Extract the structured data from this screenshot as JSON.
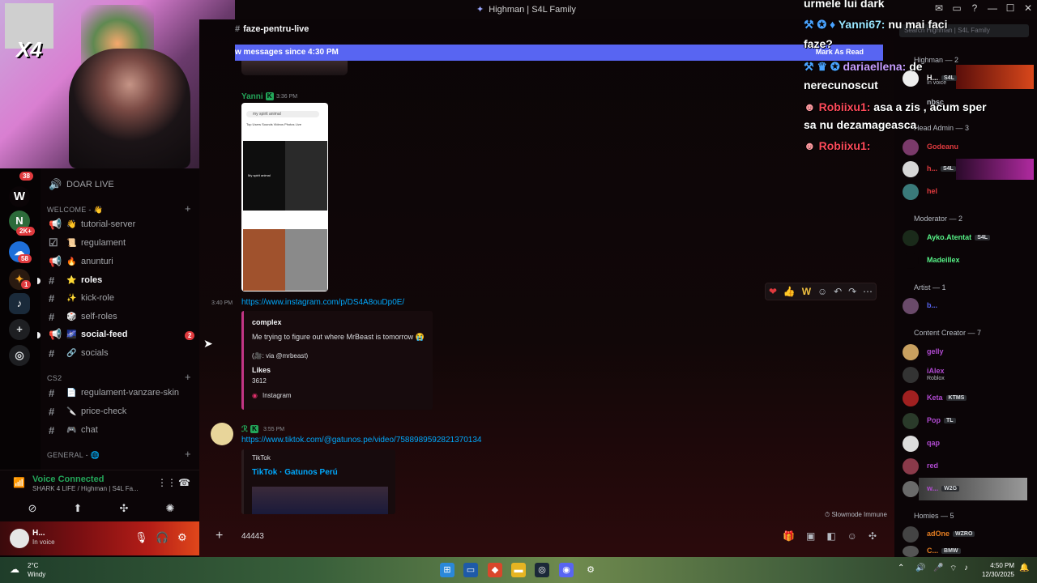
{
  "window": {
    "title": "Highman | S4L Family",
    "controls": [
      "—",
      "☐",
      "✕"
    ]
  },
  "webcam": {
    "overlay_text": "X4"
  },
  "servers": {
    "items": [
      {
        "label": "W"
      },
      {
        "label": "N",
        "badge": "2K+"
      },
      {
        "label": "☁",
        "badge": "58"
      },
      {
        "label": "✦",
        "badge": "1"
      },
      {
        "label": "♪"
      },
      {
        "label": "+"
      },
      {
        "label": "◎"
      }
    ],
    "top_badge": "38"
  },
  "channels": {
    "voice_top": "DOAR LIVE",
    "categories": {
      "welcome": "WELCOME - 👋",
      "cs2": "CS2",
      "general": "GENERAL - 🌐"
    },
    "items": [
      {
        "label": "tutorial-server",
        "emoji": "👋"
      },
      {
        "label": "regulament",
        "emoji": "📜"
      },
      {
        "label": "anunturi",
        "emoji": "🔥"
      },
      {
        "label": "roles",
        "emoji": "⭐"
      },
      {
        "label": "kick-role",
        "emoji": "✨"
      },
      {
        "label": "self-roles",
        "emoji": "🎲"
      },
      {
        "label": "social-feed",
        "emoji": "🌌",
        "badge": "2"
      },
      {
        "label": "socials",
        "emoji": "🔗"
      },
      {
        "label": "regulament-vanzare-skin",
        "emoji": "📄"
      },
      {
        "label": "price-check",
        "emoji": "🔪"
      },
      {
        "label": "chat",
        "emoji": "🎮"
      }
    ]
  },
  "voice": {
    "title": "Voice Connected",
    "subtitle": "SHARK 4 LIFE / Highman | S4L Fa..."
  },
  "user": {
    "name": "H...",
    "status": "In voice"
  },
  "chat": {
    "channel": "faze-pentru-live",
    "new_messages": "w messages since 4:30 PM",
    "mark_read": "Mark As Read",
    "messages": [
      {
        "author": "Yanni",
        "time": "3:36 PM",
        "image_search": "my spirit animal",
        "image_tabs": "Top   Users   Sounds   Videos   Photos   Live",
        "image_caption": "My spirit animal"
      },
      {
        "time": "3:40 PM",
        "link": "https://www.instagram.com/p/DS4A8ouDp0E/",
        "embed": {
          "author": "complex",
          "text": "Me trying to figure out where MrBeast is tomorrow 😭",
          "via": "(🎥: via @mrbeast)",
          "likes_label": "Likes",
          "likes": "3612",
          "provider": "Instagram"
        }
      },
      {
        "author": "ℛ",
        "time": "3:55 PM",
        "link": "https://www.tiktok.com/@gatunos.pe/video/7588989592821370134",
        "embed": {
          "provider": "TikTok",
          "title": "TikTok · Gatunos Perú"
        }
      }
    ],
    "slowmode": "Slowmode Immune",
    "composer_text": "44443"
  },
  "overlay": {
    "lines": [
      {
        "name": "",
        "text": "urmele lui dark"
      },
      {
        "name": "Yanni67:",
        "text": "nu mai faci"
      },
      {
        "name": "",
        "text": "faze?"
      },
      {
        "name": "dariaellena:",
        "text": "de"
      },
      {
        "name": "",
        "text": "nerecunoscut"
      },
      {
        "name": "Robiixu1:",
        "text": "asa a zis , acum sper"
      },
      {
        "name": "",
        "text": "sa nu dezamageasca"
      },
      {
        "name": "Robiixu1:",
        "text": ""
      }
    ]
  },
  "members": {
    "search_placeholder": "Search Highman | S4L Family",
    "groups": [
      {
        "name": "Highman — 2",
        "members": [
          {
            "name": "H...",
            "tag": "S4L",
            "sub": "In voice"
          },
          {
            "name": "nbsc",
            "tag": "",
            "sub": ""
          }
        ]
      },
      {
        "name": "Head Admin — 3",
        "members": [
          {
            "name": "Godeanu",
            "tag": ""
          },
          {
            "name": "h...",
            "tag": "S4L"
          },
          {
            "name": "hel",
            "tag": ""
          }
        ]
      },
      {
        "name": "Moderator — 2",
        "members": [
          {
            "name": "Ayko.Atentat",
            "tag": "S4L"
          },
          {
            "name": "Madeillex",
            "tag": ""
          }
        ]
      },
      {
        "name": "Artist — 1",
        "members": [
          {
            "name": "b...",
            "tag": ""
          }
        ]
      },
      {
        "name": "Content Creator — 7",
        "members": [
          {
            "name": "gelly",
            "tag": ""
          },
          {
            "name": "iAlex",
            "tag": "",
            "sub": "Roblox"
          },
          {
            "name": "Keta",
            "tag": "KTMS"
          },
          {
            "name": "Pop",
            "tag": "TL"
          },
          {
            "name": "qap",
            "tag": ""
          },
          {
            "name": "red",
            "tag": ""
          },
          {
            "name": "w...",
            "tag": "W2G"
          }
        ]
      },
      {
        "name": "Homies — 5",
        "members": [
          {
            "name": "adOne",
            "tag": "WZRO"
          },
          {
            "name": "C...",
            "tag": "BMW"
          }
        ]
      }
    ]
  },
  "taskbar": {
    "temp": "2°C",
    "weather": "Windy",
    "time": "4:50 PM",
    "date": "12/30/2025"
  },
  "colors": {
    "accent": "#5865f2",
    "link": "#00a8fc",
    "online": "#23a559",
    "badge": "#e03a3e"
  }
}
